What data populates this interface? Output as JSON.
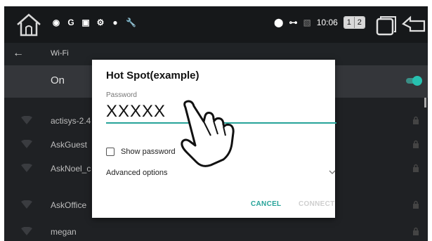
{
  "status_bar": {
    "time": "10:06",
    "screen_buttons": [
      "1",
      "2"
    ],
    "icons": [
      "home-icon",
      "location-icon",
      "g-icon",
      "calendar-icon",
      "settings-icon",
      "circle-icon",
      "wrench-icon",
      "location-pin-icon",
      "key-icon",
      "no-sim-icon",
      "recent-apps-icon",
      "back-icon"
    ]
  },
  "app_bar": {
    "title": "Wi-Fi"
  },
  "wifi_toggle": {
    "label": "On",
    "state": "on",
    "accent": "#27a399"
  },
  "networks": [
    {
      "name": "actisys-2.4"
    },
    {
      "name": "AskGuest"
    },
    {
      "name": "AskNoel_c"
    },
    {
      "name": "AskOffice"
    },
    {
      "name": "megan"
    }
  ],
  "dialog": {
    "title": "Hot Spot(example)",
    "password_label": "Password",
    "password_value": "XXXXX",
    "show_password_label": "Show password",
    "show_password_checked": false,
    "advanced_options_label": "Advanced options",
    "cancel_label": "CANCEL",
    "connect_label": "CONNECT"
  }
}
